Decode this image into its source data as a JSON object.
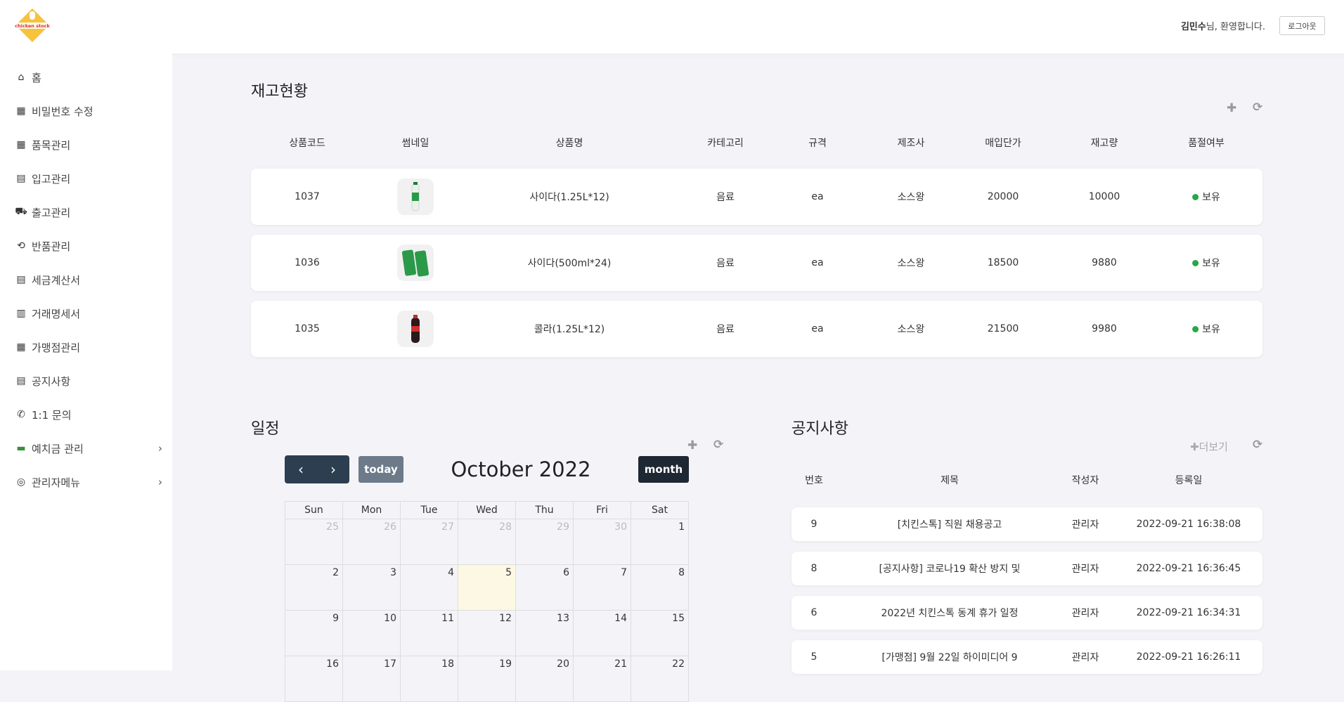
{
  "header": {
    "logo_text": "chicken stock",
    "user_name": "김민수",
    "welcome_suffix": "님, 환영합니다.",
    "logout_label": "로그아웃"
  },
  "sidebar": {
    "items": [
      {
        "label": "홈",
        "icon": "home-icon"
      },
      {
        "label": "비밀번호 수정",
        "icon": "boxes-icon"
      },
      {
        "label": "품목관리",
        "icon": "boxes-icon"
      },
      {
        "label": "입고관리",
        "icon": "cash-stack-icon"
      },
      {
        "label": "출고관리",
        "icon": "delivery-icon"
      },
      {
        "label": "반품관리",
        "icon": "return-box-icon"
      },
      {
        "label": "세금계산서",
        "icon": "invoice-icon"
      },
      {
        "label": "거래명세서",
        "icon": "statement-icon"
      },
      {
        "label": "가맹점관리",
        "icon": "store-icon"
      },
      {
        "label": "공지사항",
        "icon": "notice-icon"
      },
      {
        "label": "1:1 문의",
        "icon": "phone-icon"
      },
      {
        "label": "예치금 관리",
        "icon": "money-icon",
        "expandable": true
      },
      {
        "label": "관리자메뉴",
        "icon": "admin-user-icon",
        "expandable": true
      }
    ]
  },
  "inventory": {
    "title": "재고현황",
    "columns": [
      "상품코드",
      "썸네일",
      "상품명",
      "카테고리",
      "규격",
      "제조사",
      "매입단가",
      "재고량",
      "품절여부"
    ],
    "rows": [
      {
        "code": "1037",
        "thumb": "sprite-bottle",
        "name": "사이다(1.25L*12)",
        "category": "음료",
        "spec": "ea",
        "maker": "소스왕",
        "price": "20000",
        "stock": "10000",
        "status": "보유"
      },
      {
        "code": "1036",
        "thumb": "sprite-cans",
        "name": "사이다(500ml*24)",
        "category": "음료",
        "spec": "ea",
        "maker": "소스왕",
        "price": "18500",
        "stock": "9880",
        "status": "보유"
      },
      {
        "code": "1035",
        "thumb": "cola-bottle",
        "name": "콜라(1.25L*12)",
        "category": "음료",
        "spec": "ea",
        "maker": "소스왕",
        "price": "21500",
        "stock": "9980",
        "status": "보유"
      }
    ],
    "status_color": "#28a745"
  },
  "schedule": {
    "title": "일정",
    "today_label": "today",
    "month_label": "month",
    "calendar_title": "October 2022",
    "weekdays": [
      "Sun",
      "Mon",
      "Tue",
      "Wed",
      "Thu",
      "Fri",
      "Sat"
    ],
    "weeks": [
      [
        "25",
        "26",
        "27",
        "28",
        "29",
        "30",
        "1"
      ],
      [
        "2",
        "3",
        "4",
        "5",
        "6",
        "7",
        "8"
      ],
      [
        "9",
        "10",
        "11",
        "12",
        "13",
        "14",
        "15"
      ],
      [
        "16",
        "17",
        "18",
        "19",
        "20",
        "21",
        "22"
      ]
    ],
    "other_month_days": [
      "25",
      "26",
      "27",
      "28",
      "29",
      "30"
    ],
    "today": "5"
  },
  "notices": {
    "title": "공지사항",
    "more_label": "더보기",
    "columns": [
      "번호",
      "제목",
      "작성자",
      "등록일"
    ],
    "rows": [
      {
        "no": "9",
        "title": "[치킨스톡] 직원 채용공고",
        "author": "관리자",
        "date": "2022-09-21 16:38:08"
      },
      {
        "no": "8",
        "title": "[공지사항] 코로나19 확산 방지 및",
        "author": "관리자",
        "date": "2022-09-21 16:36:45"
      },
      {
        "no": "6",
        "title": "2022년 치킨스톡 동계 휴가 일정",
        "author": "관리자",
        "date": "2022-09-21 16:34:31"
      },
      {
        "no": "5",
        "title": "[가맹점] 9월 22일 하이미디어 9",
        "author": "관리자",
        "date": "2022-09-21 16:26:11"
      }
    ]
  }
}
